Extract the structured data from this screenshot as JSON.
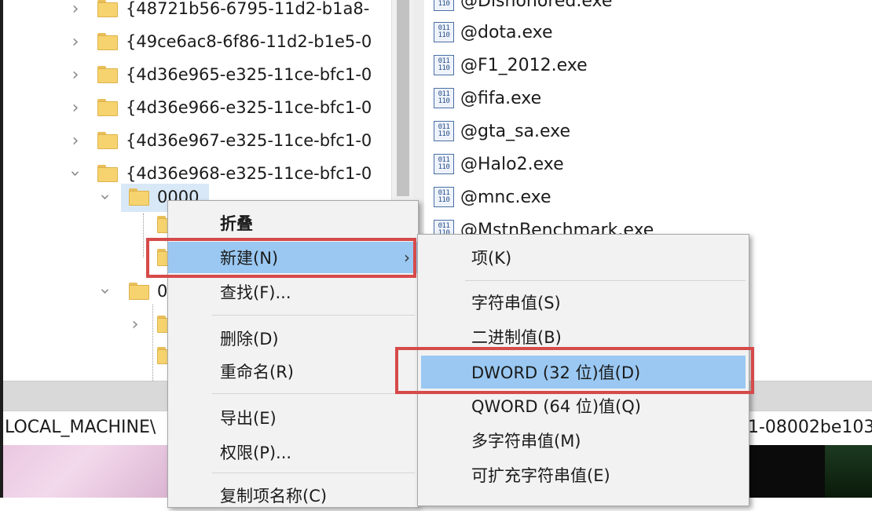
{
  "tree": {
    "items": [
      {
        "label": "{48721b56-6795-11d2-b1a8-",
        "expanded": false
      },
      {
        "label": "{49ce6ac8-6f86-11d2-b1e5-0",
        "expanded": false
      },
      {
        "label": "{4d36e965-e325-11ce-bfc1-0",
        "expanded": false
      },
      {
        "label": "{4d36e966-e325-11ce-bfc1-0",
        "expanded": false
      },
      {
        "label": "{4d36e967-e325-11ce-bfc1-0",
        "expanded": false
      },
      {
        "label": "{4d36e968-e325-11ce-bfc1-0",
        "expanded": true
      }
    ],
    "selected_child": "0000",
    "second_child_prefix": "0"
  },
  "values": {
    "items": [
      "@Dishonored.exe",
      "@dota.exe",
      "@F1_2012.exe",
      "@fifa.exe",
      "@gta_sa.exe",
      "@Halo2.exe",
      "@mnc.exe",
      "@MstnBenchmark.exe"
    ],
    "icon_text": "011\n110"
  },
  "status_bar": {
    "path_left": "LOCAL_MACHINE\\",
    "path_right": "1-08002be103"
  },
  "context_menu": {
    "items": [
      {
        "label": "折叠",
        "bold": true
      },
      {
        "label": "新建(N)",
        "has_submenu": true,
        "highlighted": true
      },
      {
        "label": "查找(F)..."
      },
      {
        "label": "删除(D)"
      },
      {
        "label": "重命名(R)"
      },
      {
        "label": "导出(E)"
      },
      {
        "label": "权限(P)..."
      },
      {
        "label": "复制项名称(C)"
      }
    ],
    "arrow": "›"
  },
  "submenu": {
    "items": [
      {
        "label": "项(K)"
      },
      {
        "label": "字符串值(S)"
      },
      {
        "label": "二进制值(B)"
      },
      {
        "label": "DWORD (32 位)值(D)",
        "highlighted": true
      },
      {
        "label": "QWORD (64 位)值(Q)"
      },
      {
        "label": "多字符串值(M)"
      },
      {
        "label": "可扩充字符串值(E)"
      }
    ]
  },
  "colors": {
    "highlight": "#9ac8f2",
    "annotation_red": "#d64a4a",
    "folder": "#f6d36f",
    "selection": "#d9e8f7"
  }
}
